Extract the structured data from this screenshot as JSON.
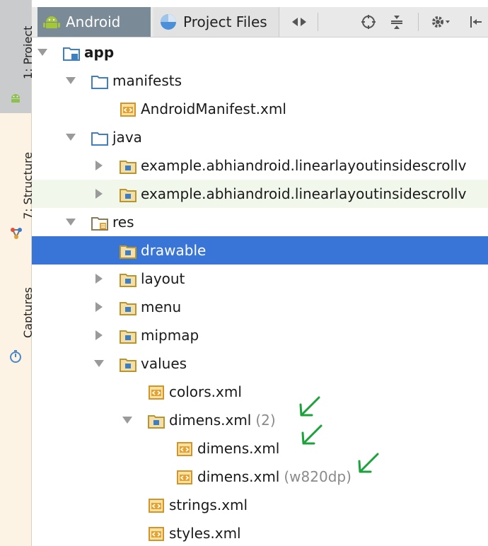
{
  "side_strip": {
    "tabs": [
      {
        "label": "1: Project",
        "active": true,
        "icon": "android-robot-icon"
      },
      {
        "label": "7: Structure",
        "active": false,
        "icon": "structure-icon"
      },
      {
        "label": "Captures",
        "active": false,
        "icon": "captures-icon"
      }
    ]
  },
  "toolbar": {
    "views": [
      {
        "label": "Android",
        "icon": "android-robot-icon",
        "selected": true
      },
      {
        "label": "Project Files",
        "icon": "project-files-icon",
        "selected": false
      }
    ],
    "buttons": [
      "expand-collapse-arrows-icon",
      "locate-target-icon",
      "collapse-all-icon",
      "gear-icon",
      "hide-panel-icon"
    ]
  },
  "tree": [
    {
      "depth": 0,
      "expanded": true,
      "icon": "module-folder-icon",
      "label": "app",
      "bold": true
    },
    {
      "depth": 1,
      "expanded": true,
      "icon": "folder-icon",
      "label": "manifests"
    },
    {
      "depth": 2,
      "expanded": null,
      "icon": "xml-file-icon",
      "label": "AndroidManifest.xml"
    },
    {
      "depth": 1,
      "expanded": true,
      "icon": "folder-icon",
      "label": "java"
    },
    {
      "depth": 2,
      "expanded": false,
      "icon": "package-icon",
      "label": "example.abhiandroid.linearlayoutinsidescrollv"
    },
    {
      "depth": 2,
      "expanded": false,
      "icon": "package-icon",
      "label": "example.abhiandroid.linearlayoutinsidescrollv"
    },
    {
      "depth": 1,
      "expanded": true,
      "icon": "res-folder-icon",
      "label": "res"
    },
    {
      "depth": 2,
      "expanded": null,
      "icon": "package-icon",
      "label": "drawable",
      "selected": true
    },
    {
      "depth": 2,
      "expanded": false,
      "icon": "package-icon",
      "label": "layout"
    },
    {
      "depth": 2,
      "expanded": false,
      "icon": "package-icon",
      "label": "menu"
    },
    {
      "depth": 2,
      "expanded": false,
      "icon": "package-icon",
      "label": "mipmap"
    },
    {
      "depth": 2,
      "expanded": true,
      "icon": "package-icon",
      "label": "values"
    },
    {
      "depth": 3,
      "expanded": null,
      "icon": "xml-file-icon",
      "label": "colors.xml"
    },
    {
      "depth": 3,
      "expanded": true,
      "icon": "package-icon",
      "label": "dimens.xml",
      "hint": "(2)",
      "annotated": true
    },
    {
      "depth": 4,
      "expanded": null,
      "icon": "xml-file-icon",
      "label": "dimens.xml",
      "annotated": true
    },
    {
      "depth": 4,
      "expanded": null,
      "icon": "xml-file-icon",
      "label": "dimens.xml",
      "hint": "(w820dp)",
      "annotated": true
    },
    {
      "depth": 3,
      "expanded": null,
      "icon": "xml-file-icon",
      "label": "strings.xml"
    },
    {
      "depth": 3,
      "expanded": null,
      "icon": "xml-file-icon",
      "label": "styles.xml"
    }
  ],
  "colors": {
    "selection": "#3875d7",
    "annotation_arrow": "#1aa33a",
    "folder_blue": "#3d7fc1",
    "xml_orange": "#e4a331"
  }
}
